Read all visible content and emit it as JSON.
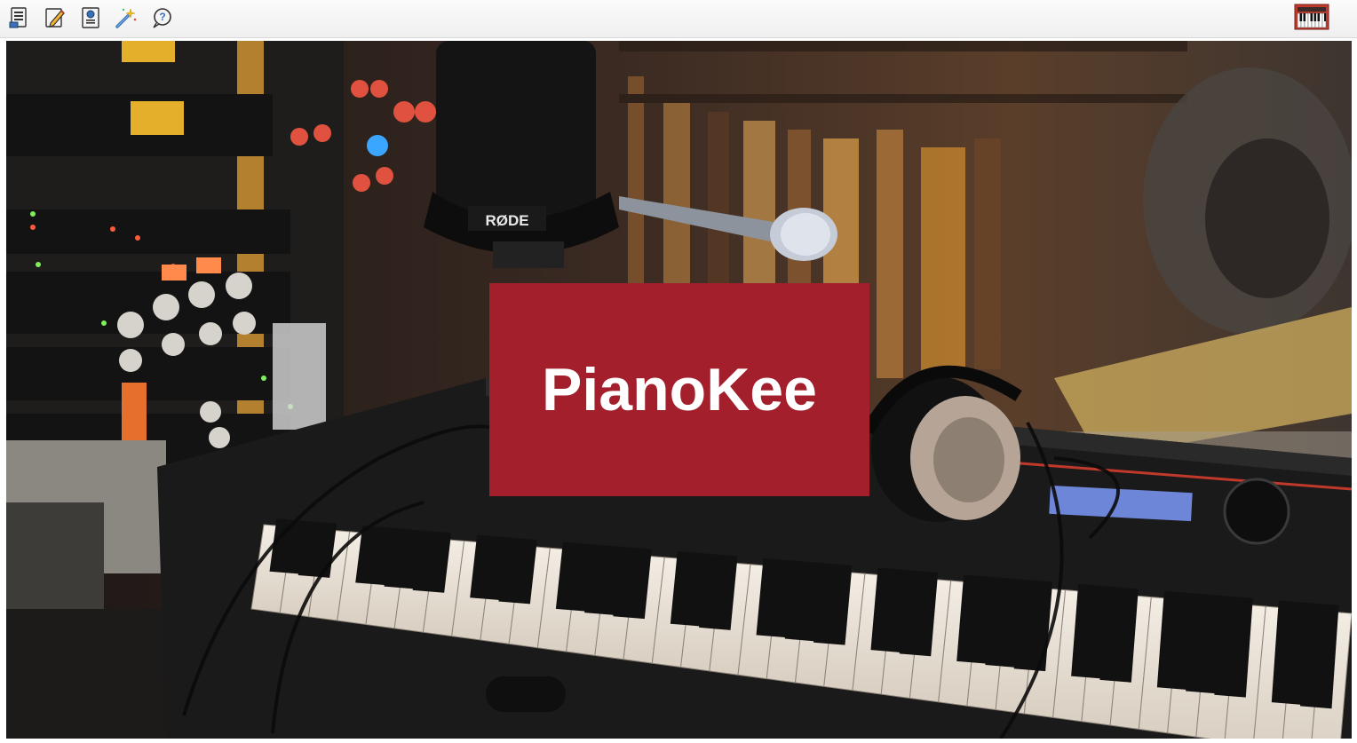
{
  "toolbar": {
    "buttons": [
      {
        "name": "list-document-icon"
      },
      {
        "name": "edit-pencil-icon"
      },
      {
        "name": "info-document-icon"
      },
      {
        "name": "magic-wand-icon"
      },
      {
        "name": "help-bubble-icon"
      }
    ],
    "app_icon": "piano-keyboard-icon"
  },
  "hero": {
    "brand": "PianoKee",
    "mic_brand": "RØDE",
    "brand_color": "#a31f2c"
  }
}
